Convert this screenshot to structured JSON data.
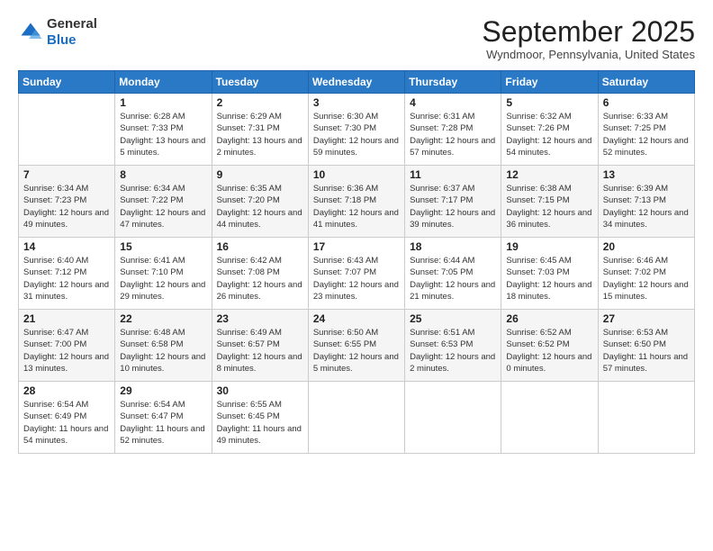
{
  "logo": {
    "general": "General",
    "blue": "Blue"
  },
  "title": "September 2025",
  "location": "Wyndmoor, Pennsylvania, United States",
  "days_of_week": [
    "Sunday",
    "Monday",
    "Tuesday",
    "Wednesday",
    "Thursday",
    "Friday",
    "Saturday"
  ],
  "weeks": [
    [
      {
        "day": "",
        "sunrise": "",
        "sunset": "",
        "daylight": ""
      },
      {
        "day": "1",
        "sunrise": "Sunrise: 6:28 AM",
        "sunset": "Sunset: 7:33 PM",
        "daylight": "Daylight: 13 hours and 5 minutes."
      },
      {
        "day": "2",
        "sunrise": "Sunrise: 6:29 AM",
        "sunset": "Sunset: 7:31 PM",
        "daylight": "Daylight: 13 hours and 2 minutes."
      },
      {
        "day": "3",
        "sunrise": "Sunrise: 6:30 AM",
        "sunset": "Sunset: 7:30 PM",
        "daylight": "Daylight: 12 hours and 59 minutes."
      },
      {
        "day": "4",
        "sunrise": "Sunrise: 6:31 AM",
        "sunset": "Sunset: 7:28 PM",
        "daylight": "Daylight: 12 hours and 57 minutes."
      },
      {
        "day": "5",
        "sunrise": "Sunrise: 6:32 AM",
        "sunset": "Sunset: 7:26 PM",
        "daylight": "Daylight: 12 hours and 54 minutes."
      },
      {
        "day": "6",
        "sunrise": "Sunrise: 6:33 AM",
        "sunset": "Sunset: 7:25 PM",
        "daylight": "Daylight: 12 hours and 52 minutes."
      }
    ],
    [
      {
        "day": "7",
        "sunrise": "Sunrise: 6:34 AM",
        "sunset": "Sunset: 7:23 PM",
        "daylight": "Daylight: 12 hours and 49 minutes."
      },
      {
        "day": "8",
        "sunrise": "Sunrise: 6:34 AM",
        "sunset": "Sunset: 7:22 PM",
        "daylight": "Daylight: 12 hours and 47 minutes."
      },
      {
        "day": "9",
        "sunrise": "Sunrise: 6:35 AM",
        "sunset": "Sunset: 7:20 PM",
        "daylight": "Daylight: 12 hours and 44 minutes."
      },
      {
        "day": "10",
        "sunrise": "Sunrise: 6:36 AM",
        "sunset": "Sunset: 7:18 PM",
        "daylight": "Daylight: 12 hours and 41 minutes."
      },
      {
        "day": "11",
        "sunrise": "Sunrise: 6:37 AM",
        "sunset": "Sunset: 7:17 PM",
        "daylight": "Daylight: 12 hours and 39 minutes."
      },
      {
        "day": "12",
        "sunrise": "Sunrise: 6:38 AM",
        "sunset": "Sunset: 7:15 PM",
        "daylight": "Daylight: 12 hours and 36 minutes."
      },
      {
        "day": "13",
        "sunrise": "Sunrise: 6:39 AM",
        "sunset": "Sunset: 7:13 PM",
        "daylight": "Daylight: 12 hours and 34 minutes."
      }
    ],
    [
      {
        "day": "14",
        "sunrise": "Sunrise: 6:40 AM",
        "sunset": "Sunset: 7:12 PM",
        "daylight": "Daylight: 12 hours and 31 minutes."
      },
      {
        "day": "15",
        "sunrise": "Sunrise: 6:41 AM",
        "sunset": "Sunset: 7:10 PM",
        "daylight": "Daylight: 12 hours and 29 minutes."
      },
      {
        "day": "16",
        "sunrise": "Sunrise: 6:42 AM",
        "sunset": "Sunset: 7:08 PM",
        "daylight": "Daylight: 12 hours and 26 minutes."
      },
      {
        "day": "17",
        "sunrise": "Sunrise: 6:43 AM",
        "sunset": "Sunset: 7:07 PM",
        "daylight": "Daylight: 12 hours and 23 minutes."
      },
      {
        "day": "18",
        "sunrise": "Sunrise: 6:44 AM",
        "sunset": "Sunset: 7:05 PM",
        "daylight": "Daylight: 12 hours and 21 minutes."
      },
      {
        "day": "19",
        "sunrise": "Sunrise: 6:45 AM",
        "sunset": "Sunset: 7:03 PM",
        "daylight": "Daylight: 12 hours and 18 minutes."
      },
      {
        "day": "20",
        "sunrise": "Sunrise: 6:46 AM",
        "sunset": "Sunset: 7:02 PM",
        "daylight": "Daylight: 12 hours and 15 minutes."
      }
    ],
    [
      {
        "day": "21",
        "sunrise": "Sunrise: 6:47 AM",
        "sunset": "Sunset: 7:00 PM",
        "daylight": "Daylight: 12 hours and 13 minutes."
      },
      {
        "day": "22",
        "sunrise": "Sunrise: 6:48 AM",
        "sunset": "Sunset: 6:58 PM",
        "daylight": "Daylight: 12 hours and 10 minutes."
      },
      {
        "day": "23",
        "sunrise": "Sunrise: 6:49 AM",
        "sunset": "Sunset: 6:57 PM",
        "daylight": "Daylight: 12 hours and 8 minutes."
      },
      {
        "day": "24",
        "sunrise": "Sunrise: 6:50 AM",
        "sunset": "Sunset: 6:55 PM",
        "daylight": "Daylight: 12 hours and 5 minutes."
      },
      {
        "day": "25",
        "sunrise": "Sunrise: 6:51 AM",
        "sunset": "Sunset: 6:53 PM",
        "daylight": "Daylight: 12 hours and 2 minutes."
      },
      {
        "day": "26",
        "sunrise": "Sunrise: 6:52 AM",
        "sunset": "Sunset: 6:52 PM",
        "daylight": "Daylight: 12 hours and 0 minutes."
      },
      {
        "day": "27",
        "sunrise": "Sunrise: 6:53 AM",
        "sunset": "Sunset: 6:50 PM",
        "daylight": "Daylight: 11 hours and 57 minutes."
      }
    ],
    [
      {
        "day": "28",
        "sunrise": "Sunrise: 6:54 AM",
        "sunset": "Sunset: 6:49 PM",
        "daylight": "Daylight: 11 hours and 54 minutes."
      },
      {
        "day": "29",
        "sunrise": "Sunrise: 6:54 AM",
        "sunset": "Sunset: 6:47 PM",
        "daylight": "Daylight: 11 hours and 52 minutes."
      },
      {
        "day": "30",
        "sunrise": "Sunrise: 6:55 AM",
        "sunset": "Sunset: 6:45 PM",
        "daylight": "Daylight: 11 hours and 49 minutes."
      },
      {
        "day": "",
        "sunrise": "",
        "sunset": "",
        "daylight": ""
      },
      {
        "day": "",
        "sunrise": "",
        "sunset": "",
        "daylight": ""
      },
      {
        "day": "",
        "sunrise": "",
        "sunset": "",
        "daylight": ""
      },
      {
        "day": "",
        "sunrise": "",
        "sunset": "",
        "daylight": ""
      }
    ]
  ]
}
